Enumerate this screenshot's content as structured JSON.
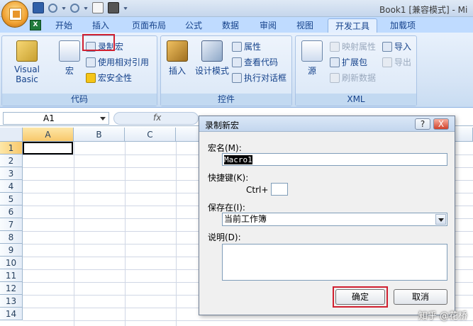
{
  "window": {
    "title": "Book1 [兼容模式] - Mi"
  },
  "tabs": [
    {
      "label": "开始"
    },
    {
      "label": "插入"
    },
    {
      "label": "页面布局"
    },
    {
      "label": "公式"
    },
    {
      "label": "数据"
    },
    {
      "label": "审阅"
    },
    {
      "label": "视图"
    },
    {
      "label": "开发工具",
      "active": true
    },
    {
      "label": "加载项"
    }
  ],
  "ribbon": {
    "code_group": {
      "label": "代码",
      "visual_basic": "Visual Basic",
      "macros": "宏",
      "record_macro": "录制宏",
      "relative_ref": "使用相对引用",
      "macro_security": "宏安全性"
    },
    "controls_group": {
      "label": "控件",
      "insert": "插入",
      "design_mode": "设计模式",
      "properties": "属性",
      "view_code": "查看代码",
      "run_dialog": "执行对话框"
    },
    "xml_group": {
      "label": "XML",
      "source": "源",
      "map_properties": "映射属性",
      "expansion_packs": "扩展包",
      "refresh_data": "刷新数据",
      "import": "导入",
      "export": "导出"
    }
  },
  "formula_bar": {
    "name_box": "A1",
    "fx": "fx"
  },
  "sheet": {
    "columns": [
      "A",
      "B",
      "C"
    ],
    "rows": [
      "1",
      "2",
      "3",
      "4",
      "5",
      "6",
      "7",
      "8",
      "9",
      "10",
      "11",
      "12",
      "13",
      "14"
    ]
  },
  "dialog": {
    "title": "录制新宏",
    "help": "?",
    "close": "X",
    "macro_name_label": "宏名(M):",
    "macro_name_value": "Macro1",
    "shortcut_label": "快捷键(K):",
    "ctrl_label": "Ctrl+",
    "store_in_label": "保存在(I):",
    "store_in_value": "当前工作簿",
    "description_label": "说明(D):",
    "ok": "确定",
    "cancel": "取消"
  },
  "watermark": "知乎 @花桥",
  "colors": {
    "highlight": "#d02030",
    "ribbon_bg": "#dae7f7",
    "active_tab": "#e3efff"
  }
}
